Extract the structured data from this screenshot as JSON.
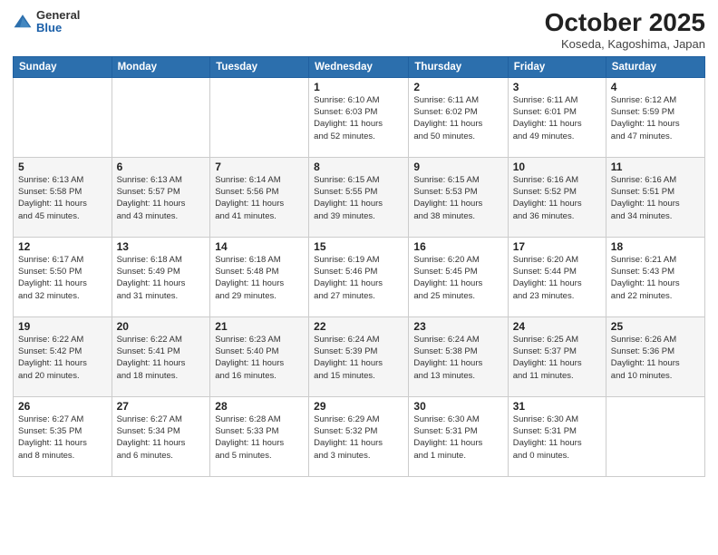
{
  "logo": {
    "general": "General",
    "blue": "Blue"
  },
  "title": "October 2025",
  "subtitle": "Koseda, Kagoshima, Japan",
  "days_header": [
    "Sunday",
    "Monday",
    "Tuesday",
    "Wednesday",
    "Thursday",
    "Friday",
    "Saturday"
  ],
  "weeks": [
    [
      {
        "day": "",
        "info": ""
      },
      {
        "day": "",
        "info": ""
      },
      {
        "day": "",
        "info": ""
      },
      {
        "day": "1",
        "info": "Sunrise: 6:10 AM\nSunset: 6:03 PM\nDaylight: 11 hours\nand 52 minutes."
      },
      {
        "day": "2",
        "info": "Sunrise: 6:11 AM\nSunset: 6:02 PM\nDaylight: 11 hours\nand 50 minutes."
      },
      {
        "day": "3",
        "info": "Sunrise: 6:11 AM\nSunset: 6:01 PM\nDaylight: 11 hours\nand 49 minutes."
      },
      {
        "day": "4",
        "info": "Sunrise: 6:12 AM\nSunset: 5:59 PM\nDaylight: 11 hours\nand 47 minutes."
      }
    ],
    [
      {
        "day": "5",
        "info": "Sunrise: 6:13 AM\nSunset: 5:58 PM\nDaylight: 11 hours\nand 45 minutes."
      },
      {
        "day": "6",
        "info": "Sunrise: 6:13 AM\nSunset: 5:57 PM\nDaylight: 11 hours\nand 43 minutes."
      },
      {
        "day": "7",
        "info": "Sunrise: 6:14 AM\nSunset: 5:56 PM\nDaylight: 11 hours\nand 41 minutes."
      },
      {
        "day": "8",
        "info": "Sunrise: 6:15 AM\nSunset: 5:55 PM\nDaylight: 11 hours\nand 39 minutes."
      },
      {
        "day": "9",
        "info": "Sunrise: 6:15 AM\nSunset: 5:53 PM\nDaylight: 11 hours\nand 38 minutes."
      },
      {
        "day": "10",
        "info": "Sunrise: 6:16 AM\nSunset: 5:52 PM\nDaylight: 11 hours\nand 36 minutes."
      },
      {
        "day": "11",
        "info": "Sunrise: 6:16 AM\nSunset: 5:51 PM\nDaylight: 11 hours\nand 34 minutes."
      }
    ],
    [
      {
        "day": "12",
        "info": "Sunrise: 6:17 AM\nSunset: 5:50 PM\nDaylight: 11 hours\nand 32 minutes."
      },
      {
        "day": "13",
        "info": "Sunrise: 6:18 AM\nSunset: 5:49 PM\nDaylight: 11 hours\nand 31 minutes."
      },
      {
        "day": "14",
        "info": "Sunrise: 6:18 AM\nSunset: 5:48 PM\nDaylight: 11 hours\nand 29 minutes."
      },
      {
        "day": "15",
        "info": "Sunrise: 6:19 AM\nSunset: 5:46 PM\nDaylight: 11 hours\nand 27 minutes."
      },
      {
        "day": "16",
        "info": "Sunrise: 6:20 AM\nSunset: 5:45 PM\nDaylight: 11 hours\nand 25 minutes."
      },
      {
        "day": "17",
        "info": "Sunrise: 6:20 AM\nSunset: 5:44 PM\nDaylight: 11 hours\nand 23 minutes."
      },
      {
        "day": "18",
        "info": "Sunrise: 6:21 AM\nSunset: 5:43 PM\nDaylight: 11 hours\nand 22 minutes."
      }
    ],
    [
      {
        "day": "19",
        "info": "Sunrise: 6:22 AM\nSunset: 5:42 PM\nDaylight: 11 hours\nand 20 minutes."
      },
      {
        "day": "20",
        "info": "Sunrise: 6:22 AM\nSunset: 5:41 PM\nDaylight: 11 hours\nand 18 minutes."
      },
      {
        "day": "21",
        "info": "Sunrise: 6:23 AM\nSunset: 5:40 PM\nDaylight: 11 hours\nand 16 minutes."
      },
      {
        "day": "22",
        "info": "Sunrise: 6:24 AM\nSunset: 5:39 PM\nDaylight: 11 hours\nand 15 minutes."
      },
      {
        "day": "23",
        "info": "Sunrise: 6:24 AM\nSunset: 5:38 PM\nDaylight: 11 hours\nand 13 minutes."
      },
      {
        "day": "24",
        "info": "Sunrise: 6:25 AM\nSunset: 5:37 PM\nDaylight: 11 hours\nand 11 minutes."
      },
      {
        "day": "25",
        "info": "Sunrise: 6:26 AM\nSunset: 5:36 PM\nDaylight: 11 hours\nand 10 minutes."
      }
    ],
    [
      {
        "day": "26",
        "info": "Sunrise: 6:27 AM\nSunset: 5:35 PM\nDaylight: 11 hours\nand 8 minutes."
      },
      {
        "day": "27",
        "info": "Sunrise: 6:27 AM\nSunset: 5:34 PM\nDaylight: 11 hours\nand 6 minutes."
      },
      {
        "day": "28",
        "info": "Sunrise: 6:28 AM\nSunset: 5:33 PM\nDaylight: 11 hours\nand 5 minutes."
      },
      {
        "day": "29",
        "info": "Sunrise: 6:29 AM\nSunset: 5:32 PM\nDaylight: 11 hours\nand 3 minutes."
      },
      {
        "day": "30",
        "info": "Sunrise: 6:30 AM\nSunset: 5:31 PM\nDaylight: 11 hours\nand 1 minute."
      },
      {
        "day": "31",
        "info": "Sunrise: 6:30 AM\nSunset: 5:31 PM\nDaylight: 11 hours\nand 0 minutes."
      },
      {
        "day": "",
        "info": ""
      }
    ]
  ]
}
